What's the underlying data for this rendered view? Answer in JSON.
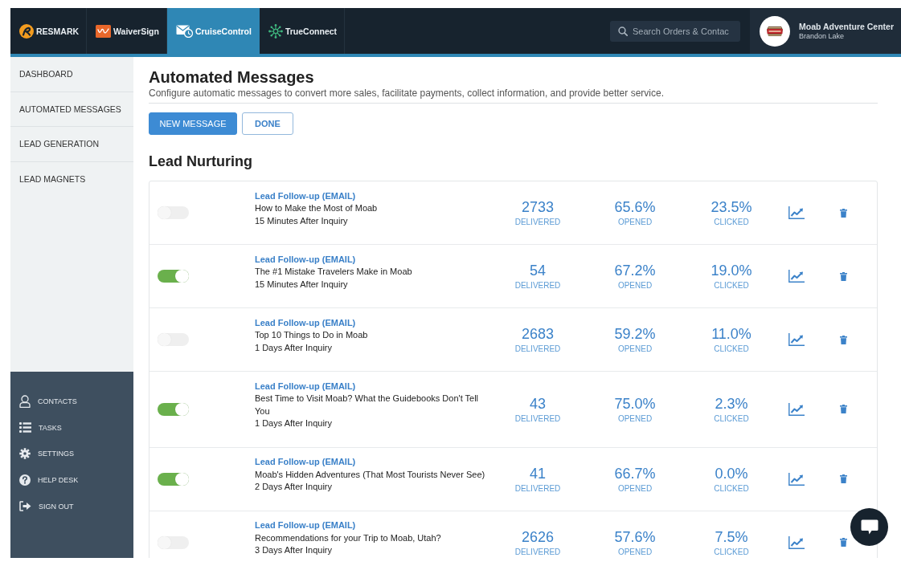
{
  "top_bar": {
    "apps": [
      {
        "label": "RESMARK",
        "kind": "resmark",
        "selected": false
      },
      {
        "label": "WaiverSign",
        "kind": "waiversign",
        "selected": false
      },
      {
        "label": "CruiseControl",
        "kind": "cruisecontrol",
        "selected": true
      },
      {
        "label": "TrueConnect",
        "kind": "trueconnect",
        "selected": false
      }
    ],
    "search": {
      "placeholder": "Search Orders & Contac"
    },
    "account": {
      "name": "Moab Adventure Center",
      "user": "Brandon Lake"
    }
  },
  "sidebar": {
    "nav": [
      {
        "label": "DASHBOARD"
      },
      {
        "label": "AUTOMATED MESSAGES"
      },
      {
        "label": "LEAD GENERATION"
      },
      {
        "label": "LEAD MAGNETS"
      }
    ],
    "menu": [
      {
        "label": "CONTACTS",
        "kind": "contacts"
      },
      {
        "label": "TASKS",
        "kind": "tasks"
      },
      {
        "label": "SETTINGS",
        "kind": "settings"
      },
      {
        "label": "HELP DESK",
        "kind": "help"
      },
      {
        "label": "SIGN OUT",
        "kind": "signout"
      }
    ]
  },
  "page": {
    "title": "Automated Messages",
    "description": "Configure automatic messages to convert more sales, facilitate payments, collect information, and provide better service.",
    "buttons": [
      {
        "label": "NEW MESSAGE",
        "kind": "primary"
      },
      {
        "label": "DONE",
        "kind": "secondary"
      }
    ]
  },
  "section": {
    "title": "Lead Nurturing",
    "messages": [
      {
        "on": false,
        "type": "Lead Follow-up (EMAIL)",
        "subject": "How to Make the Most of Moab",
        "timing": "15 Minutes After Inquiry",
        "stats": [
          {
            "value": "2733",
            "label": "DELIVERED"
          },
          {
            "value": "65.6%",
            "label": "OPENED"
          },
          {
            "value": "23.5%",
            "label": "CLICKED"
          }
        ]
      },
      {
        "on": true,
        "type": "Lead Follow-up (EMAIL)",
        "subject": "The #1 Mistake Travelers Make in Moab",
        "timing": "15 Minutes After Inquiry",
        "stats": [
          {
            "value": "54",
            "label": "DELIVERED"
          },
          {
            "value": "67.2%",
            "label": "OPENED"
          },
          {
            "value": "19.0%",
            "label": "CLICKED"
          }
        ]
      },
      {
        "on": false,
        "type": "Lead Follow-up (EMAIL)",
        "subject": "Top 10 Things to Do in Moab",
        "timing": "1 Days After Inquiry",
        "stats": [
          {
            "value": "2683",
            "label": "DELIVERED"
          },
          {
            "value": "59.2%",
            "label": "OPENED"
          },
          {
            "value": "11.0%",
            "label": "CLICKED"
          }
        ]
      },
      {
        "on": true,
        "type": "Lead Follow-up (EMAIL)",
        "subject": "Best Time to Visit Moab? What the Guidebooks Don't Tell You",
        "timing": "1 Days After Inquiry",
        "stats": [
          {
            "value": "43",
            "label": "DELIVERED"
          },
          {
            "value": "75.0%",
            "label": "OPENED"
          },
          {
            "value": "2.3%",
            "label": "CLICKED"
          }
        ]
      },
      {
        "on": true,
        "type": "Lead Follow-up (EMAIL)",
        "subject": "Moab's Hidden Adventures (That Most Tourists Never See)",
        "timing": "2 Days After Inquiry",
        "stats": [
          {
            "value": "41",
            "label": "DELIVERED"
          },
          {
            "value": "66.7%",
            "label": "OPENED"
          },
          {
            "value": "0.0%",
            "label": "CLICKED"
          }
        ]
      },
      {
        "on": false,
        "type": "Lead Follow-up (EMAIL)",
        "subject": "Recommendations for your Trip to Moab, Utah?",
        "timing": "3 Days After Inquiry",
        "stats": [
          {
            "value": "2626",
            "label": "DELIVERED"
          },
          {
            "value": "57.6%",
            "label": "OPENED"
          },
          {
            "value": "7.5%",
            "label": "CLICKED"
          }
        ]
      }
    ]
  }
}
